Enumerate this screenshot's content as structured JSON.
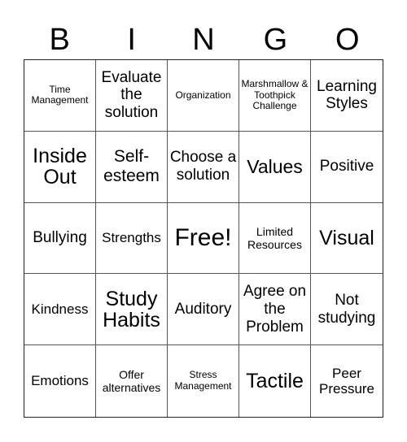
{
  "header": {
    "letters": [
      "B",
      "I",
      "N",
      "G",
      "O"
    ]
  },
  "cells": [
    [
      "Time Management",
      "Evaluate the solution",
      "Organization",
      "Marshmallow & Toothpick Challenge",
      "Learning Styles"
    ],
    [
      "Inside Out",
      "Self-esteem",
      "Choose a solution",
      "Values",
      "Positive"
    ],
    [
      "Bullying",
      "Strengths",
      "Free!",
      "Limited Resources",
      "Visual"
    ],
    [
      "Kindness",
      "Study Habits",
      "Auditory",
      "Agree on the Problem",
      "Not studying"
    ],
    [
      "Emotions",
      "Offer alternatives",
      "Stress Management",
      "Tactile",
      "Peer Pressure"
    ]
  ],
  "free_cell": "Free!"
}
